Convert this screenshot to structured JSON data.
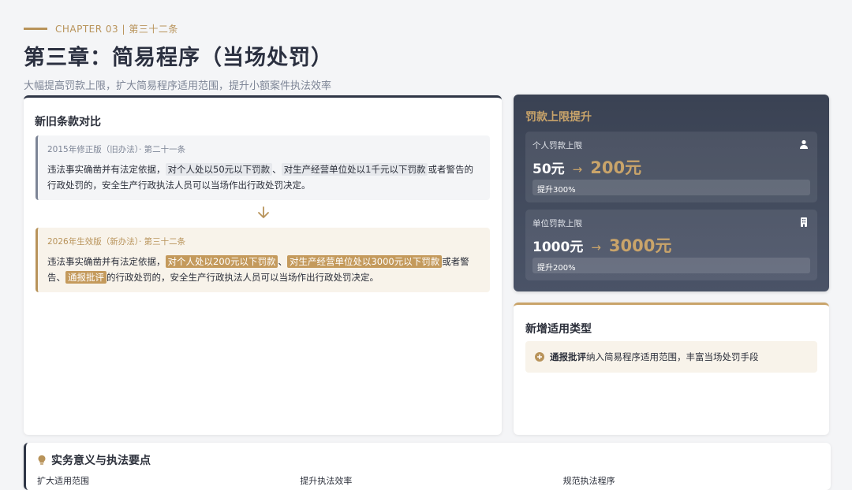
{
  "header": {
    "chapter": "CHAPTER 03 | 第三十二条",
    "title": "第三章：简易程序（当场处罚）",
    "subtitle": "大幅提高罚款上限，扩大简易程序适用范围，提升小额案件执法效率"
  },
  "compare": {
    "title": "新旧条款对比",
    "old": {
      "label": "2015年修正版（旧办法）· 第二十一条",
      "t1": "违法事实确凿并有法定依据，",
      "h1": "对个人处以50元以下罚款",
      "t2": "、",
      "h2": "对生产经营单位处以1千元以下罚款",
      "t3": "或者警告的行政处罚的，安全生产行政执法人员可以当场作出行政处罚决定。"
    },
    "new": {
      "label": "2026年生效版（新办法）· 第三十二条",
      "t1": "违法事实确凿并有法定依据，",
      "h1": "对个人处以200元以下罚款",
      "t2": "、",
      "h2": "对生产经营单位处以3000元以下罚款",
      "t3": "或者警告、",
      "h3": "通报批评",
      "t4": "的行政处罚的，安全生产行政执法人员可以当场作出行政处罚决定。"
    }
  },
  "fine": {
    "title": "罚款上限提升",
    "personal": {
      "label": "个人罚款上限",
      "icon": "user-icon",
      "old": "50元",
      "arrow": "→",
      "new": "200元",
      "increase": "提升300%"
    },
    "company": {
      "label": "单位罚款上限",
      "icon": "building-icon",
      "old": "1000元",
      "arrow": "→",
      "new": "3000元",
      "increase": "提升200%"
    }
  },
  "types": {
    "title": "新增适用类型",
    "item_strong": "通报批评",
    "item_text": "纳入简易程序适用范围，丰富当场处罚手段"
  },
  "practice": {
    "title": "实务意义与执法要点",
    "col1": "扩大适用范围",
    "col2": "提升执法效率",
    "col3": "规范执法程序"
  },
  "colors": {
    "accent": "#b8935a",
    "dark": "#2f3646"
  }
}
